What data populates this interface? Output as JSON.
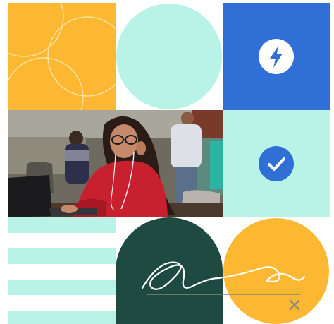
{
  "colors": {
    "yellow": "#FDB833",
    "mint": "#B9F2E6",
    "blue": "#2F6FD6",
    "dark_green": "#1E4A42",
    "white": "#FFFFFF",
    "close_gray": "#8C8A80"
  },
  "icons": {
    "blue_tile": "lightning-bolt-icon",
    "mint_tile": "checkmark-icon",
    "close": "close-icon"
  },
  "photo": {
    "subject": "woman-with-glasses-and-earphones-using-laptop"
  }
}
